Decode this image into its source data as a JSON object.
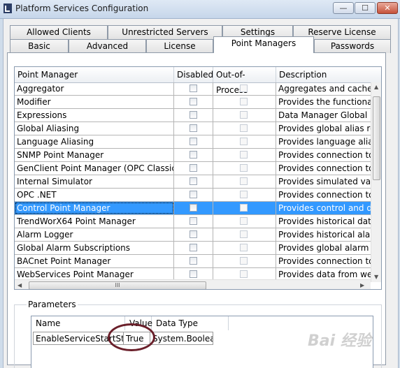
{
  "window": {
    "title": "Platform Services Configuration",
    "minimize_glyph": "—",
    "maximize_glyph": "☐",
    "close_glyph": "✕"
  },
  "tabs": {
    "row1": [
      "Allowed Clients",
      "Unrestricted Servers",
      "Settings",
      "Reserve License"
    ],
    "row2": [
      "Basic",
      "Advanced",
      "License",
      "Point Managers",
      "Passwords"
    ],
    "active": "Point Managers"
  },
  "grid": {
    "columns": [
      "Point Manager",
      "Disabled",
      "Out-of-Process",
      "Description"
    ],
    "rows": [
      {
        "name": "Aggregator",
        "description": "Aggregates and caches c"
      },
      {
        "name": "Modifier",
        "description": "Provides the functionality"
      },
      {
        "name": "Expressions",
        "description": "Data Manager Global Exp"
      },
      {
        "name": "Global Aliasing",
        "description": "Provides global alias reso"
      },
      {
        "name": "Language Aliasing",
        "description": "Provides language aliasin"
      },
      {
        "name": "SNMP Point Manager",
        "description": "Provides connection to S"
      },
      {
        "name": "GenClient Point Manager (OPC Classic)",
        "description": "Provides connection to O"
      },
      {
        "name": "Internal Simulator",
        "description": "Provides simulated value"
      },
      {
        "name": "OPC .NET",
        "description": "Provides connection to O"
      },
      {
        "name": "Control Point Manager",
        "description": "Provides control and diag"
      },
      {
        "name": "TrendWorX64 Point Manager",
        "description": "Provides historical data lo"
      },
      {
        "name": "Alarm Logger",
        "description": "Provides historical alarms"
      },
      {
        "name": "Global Alarm Subscriptions",
        "description": "Provides global alarm su"
      },
      {
        "name": "BACnet Point Manager",
        "description": "Provides connection to B"
      },
      {
        "name": "WebServices Point Manager",
        "description": "Provides data from web s"
      }
    ],
    "selected_row": "Control Point Manager",
    "hscroll_grip": "III"
  },
  "parameters": {
    "label": "Parameters",
    "columns": [
      "Name",
      "Value",
      "Data Type"
    ],
    "rows": [
      {
        "name": "EnableServiceStartStop",
        "value": "True",
        "type": "System.Boolean"
      }
    ]
  },
  "watermark": "Bai 经验"
}
